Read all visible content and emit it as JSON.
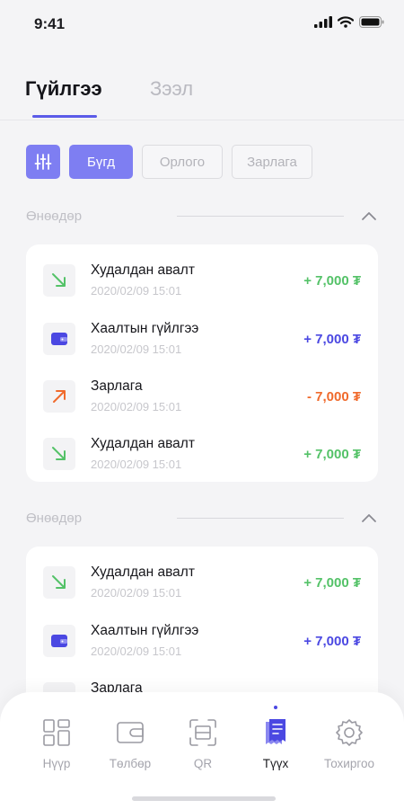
{
  "status_bar": {
    "time": "9:41"
  },
  "tabs": [
    {
      "label": "Гүйлгээ",
      "active": true
    },
    {
      "label": "Зээл",
      "active": false
    }
  ],
  "filters": {
    "icon": "sliders-icon",
    "chips": [
      {
        "label": "Бүгд",
        "active": true
      },
      {
        "label": "Орлого",
        "active": false
      },
      {
        "label": "Зарлага",
        "active": false
      }
    ]
  },
  "sections": [
    {
      "title": "Өнөөдөр",
      "transactions": [
        {
          "title": "Худалдан авалт",
          "date": "2020/02/09 15:01",
          "amount": "+ 7,000 ₮",
          "icon": "arrow-down-right-icon",
          "kind": "in"
        },
        {
          "title": "Хаалтын гүйлгээ",
          "date": "2020/02/09 15:01",
          "amount": "+ 7,000 ₮",
          "icon": "wallet-icon",
          "kind": "wallet"
        },
        {
          "title": "Зарлага",
          "date": "2020/02/09 15:01",
          "amount": "- 7,000 ₮",
          "icon": "arrow-up-right-icon",
          "kind": "out"
        },
        {
          "title": "Худалдан авалт",
          "date": "2020/02/09 15:01",
          "amount": "+ 7,000 ₮",
          "icon": "arrow-down-right-icon",
          "kind": "in"
        }
      ]
    },
    {
      "title": "Өнөөдөр",
      "transactions": [
        {
          "title": "Худалдан авалт",
          "date": "2020/02/09 15:01",
          "amount": "+ 7,000 ₮",
          "icon": "arrow-down-right-icon",
          "kind": "in"
        },
        {
          "title": "Хаалтын гүйлгээ",
          "date": "2020/02/09 15:01",
          "amount": "+ 7,000 ₮",
          "icon": "wallet-icon",
          "kind": "wallet"
        },
        {
          "title": "Зарлага",
          "icon": "arrow-up-right-icon",
          "kind": "out"
        }
      ]
    }
  ],
  "bottom_nav": [
    {
      "label": "Нүүр",
      "icon": "grid-icon",
      "active": false
    },
    {
      "label": "Төлбөр",
      "icon": "wallet-icon",
      "active": false
    },
    {
      "label": "QR",
      "icon": "qr-scan-icon",
      "active": false
    },
    {
      "label": "Түүх",
      "icon": "receipt-icon",
      "active": true
    },
    {
      "label": "Тохиргоо",
      "icon": "gear-icon",
      "active": false
    }
  ],
  "colors": {
    "accent": "#5B5BE8",
    "chip_active": "#7E7EF2",
    "income": "#54C268",
    "wallet": "#4B48E2",
    "expense": "#F06A2C"
  }
}
